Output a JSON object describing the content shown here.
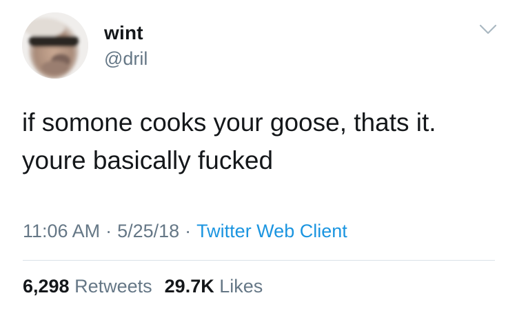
{
  "user": {
    "display_name": "wint",
    "handle": "@dril"
  },
  "tweet": {
    "line1": "if somone cooks your goose, thats it.",
    "line2": "youre basically fucked"
  },
  "meta": {
    "time": "11:06 AM",
    "separator": "·",
    "date": "5/25/18",
    "client": "Twitter Web Client"
  },
  "stats": {
    "retweets_count": "6,298",
    "retweets_label": "Retweets",
    "likes_count": "29.7K",
    "likes_label": "Likes"
  },
  "icons": {
    "avatar": "profile-photo",
    "menu": "chevron-down-icon"
  },
  "colors": {
    "text": "#14171a",
    "secondary": "#657786",
    "link": "#1b95e0",
    "divider": "#d9e1e8"
  }
}
